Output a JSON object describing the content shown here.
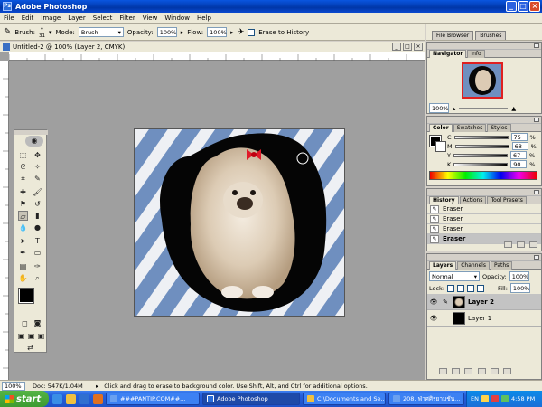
{
  "app": {
    "title": "Adobe Photoshop"
  },
  "menu": [
    "File",
    "Edit",
    "Image",
    "Layer",
    "Select",
    "Filter",
    "View",
    "Window",
    "Help"
  ],
  "options": {
    "brush_label": "Brush:",
    "brush_size": "31",
    "mode_label": "Mode:",
    "mode_value": "Brush",
    "opacity_label": "Opacity:",
    "opacity_value": "100%",
    "flow_label": "Flow:",
    "flow_value": "100%",
    "erase_history_label": "Erase to History"
  },
  "palette_well": {
    "tabs": [
      "File Browser",
      "Brushes"
    ]
  },
  "document": {
    "title": "Untitled-2 @ 100% (Layer 2, CMYK)"
  },
  "navigator": {
    "tabs": [
      "Navigator",
      "Info"
    ],
    "zoom": "100%"
  },
  "color": {
    "tabs": [
      "Color",
      "Swatches",
      "Styles"
    ],
    "channels": [
      {
        "label": "C",
        "value": "75"
      },
      {
        "label": "M",
        "value": "68"
      },
      {
        "label": "Y",
        "value": "67"
      },
      {
        "label": "K",
        "value": "90"
      }
    ]
  },
  "history": {
    "tabs": [
      "History",
      "Actions",
      "Tool Presets"
    ],
    "items": [
      "Eraser",
      "Eraser",
      "Eraser",
      "Eraser"
    ]
  },
  "layers": {
    "tabs": [
      "Layers",
      "Channels",
      "Paths"
    ],
    "blend_mode": "Normal",
    "opacity_label": "Opacity:",
    "opacity_value": "100%",
    "lock_label": "Lock:",
    "fill_label": "Fill:",
    "fill_value": "100%",
    "items": [
      "Layer 2",
      "Layer 1"
    ]
  },
  "status": {
    "zoom": "100%",
    "doc": "Doc: 547K/1.04M",
    "hint": "Click and drag to erase to background color. Use Shift, Alt, and Ctrl for additional options."
  },
  "taskbar": {
    "start": "start",
    "tasks": [
      "###PANTIP.COM##...",
      "Adobe Photoshop",
      "C:\\Documents and Se...",
      "208. ฟ่าศศิรยามชัน..."
    ],
    "lang": "EN",
    "time": "4:58 PM"
  },
  "colors": {
    "titlebar": "#0a56e0",
    "taskbar": "#245edb",
    "start": "#3c9b30",
    "foreground": "#000000",
    "background": "#ffffff"
  }
}
